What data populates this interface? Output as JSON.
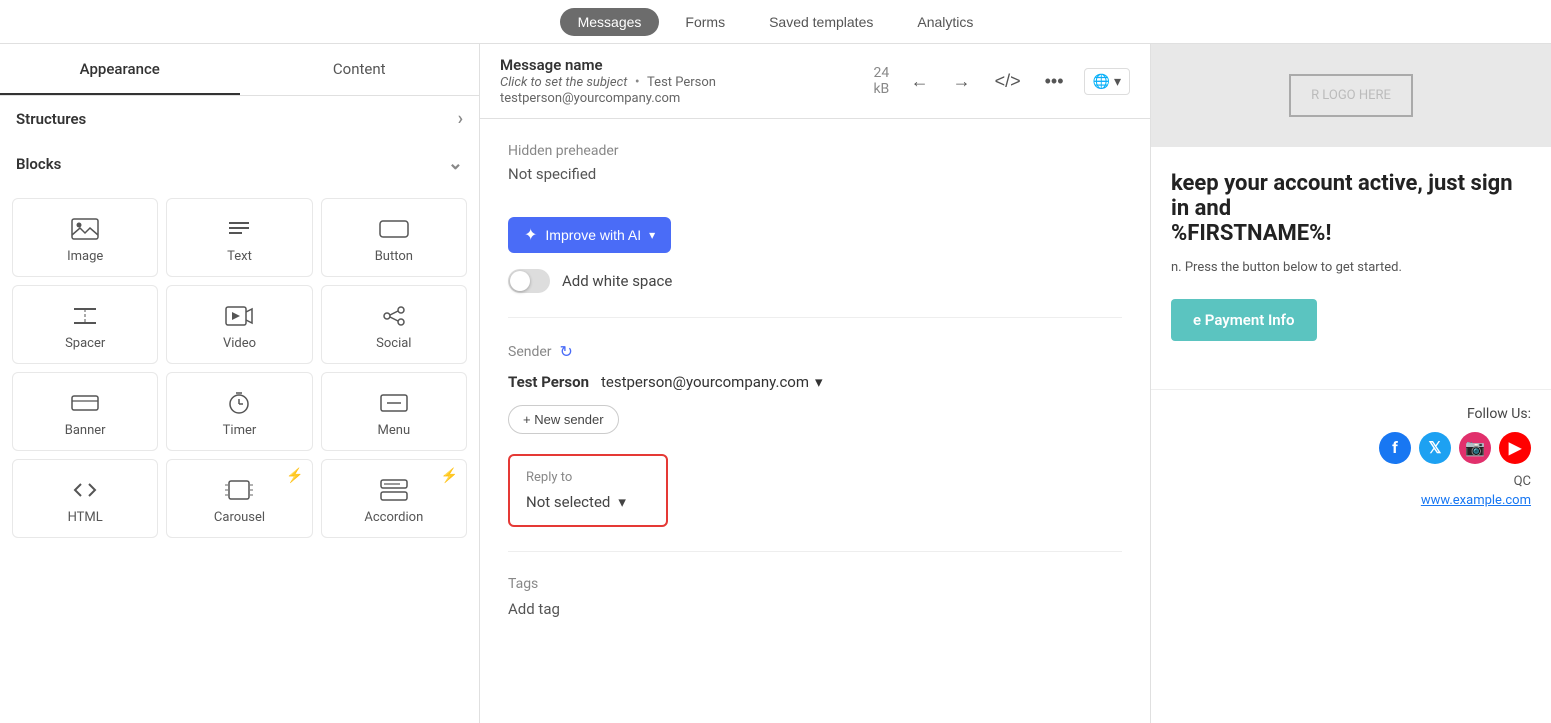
{
  "topNav": {
    "tabs": [
      {
        "id": "messages",
        "label": "Messages",
        "active": true
      },
      {
        "id": "forms",
        "label": "Forms",
        "active": false
      },
      {
        "id": "saved-templates",
        "label": "Saved templates",
        "active": false
      },
      {
        "id": "analytics",
        "label": "Analytics",
        "active": false
      }
    ]
  },
  "leftPanel": {
    "tabs": [
      {
        "id": "appearance",
        "label": "Appearance",
        "active": true
      },
      {
        "id": "content",
        "label": "Content",
        "active": false
      }
    ],
    "structures": {
      "label": "Structures"
    },
    "blocks": {
      "label": "Blocks",
      "items": [
        {
          "id": "image",
          "label": "Image",
          "icon": "image",
          "badge": false
        },
        {
          "id": "text",
          "label": "Text",
          "icon": "text",
          "badge": false
        },
        {
          "id": "button",
          "label": "Button",
          "icon": "button",
          "badge": false
        },
        {
          "id": "spacer",
          "label": "Spacer",
          "icon": "spacer",
          "badge": false
        },
        {
          "id": "video",
          "label": "Video",
          "icon": "video",
          "badge": false
        },
        {
          "id": "social",
          "label": "Social",
          "icon": "social",
          "badge": false
        },
        {
          "id": "banner",
          "label": "Banner",
          "icon": "banner",
          "badge": false
        },
        {
          "id": "timer",
          "label": "Timer",
          "icon": "timer",
          "badge": false
        },
        {
          "id": "menu",
          "label": "Menu",
          "icon": "menu",
          "badge": false
        },
        {
          "id": "html",
          "label": "HTML",
          "icon": "html",
          "badge": false
        },
        {
          "id": "carousel",
          "label": "Carousel",
          "icon": "carousel",
          "badge": true
        },
        {
          "id": "accordion",
          "label": "Accordion",
          "icon": "accordion",
          "badge": true
        }
      ]
    }
  },
  "centerPanel": {
    "messageName": "Message name",
    "clickToSet": "Click to set the subject",
    "senderEmailHeader": "Test Person testperson@yourcompany.com",
    "kbLabel": "24 kB",
    "hiddenPreheader": {
      "label": "Hidden preheader",
      "value": "Not specified"
    },
    "improveBtn": "Improve with AI",
    "addWhiteSpace": "Add white space",
    "sender": {
      "label": "Sender",
      "name": "Test Person",
      "email": "testperson@yourcompany.com",
      "newSenderBtn": "+ New sender"
    },
    "replyTo": {
      "label": "Reply to",
      "value": "Not selected"
    },
    "tags": {
      "label": "Tags",
      "value": "Add tag"
    }
  },
  "previewPanel": {
    "logoPlaceholder": "R LOGO HERE",
    "headline": "%FIRSTNAME%!",
    "headlinePrefix": "keep your account active, just sign in and",
    "bodyText": "n. Press the button below to get started.",
    "paymentBtn": "e Payment Info",
    "followUs": "Follow Us:",
    "locationText": "QC",
    "websiteLink": "www.example.com"
  }
}
